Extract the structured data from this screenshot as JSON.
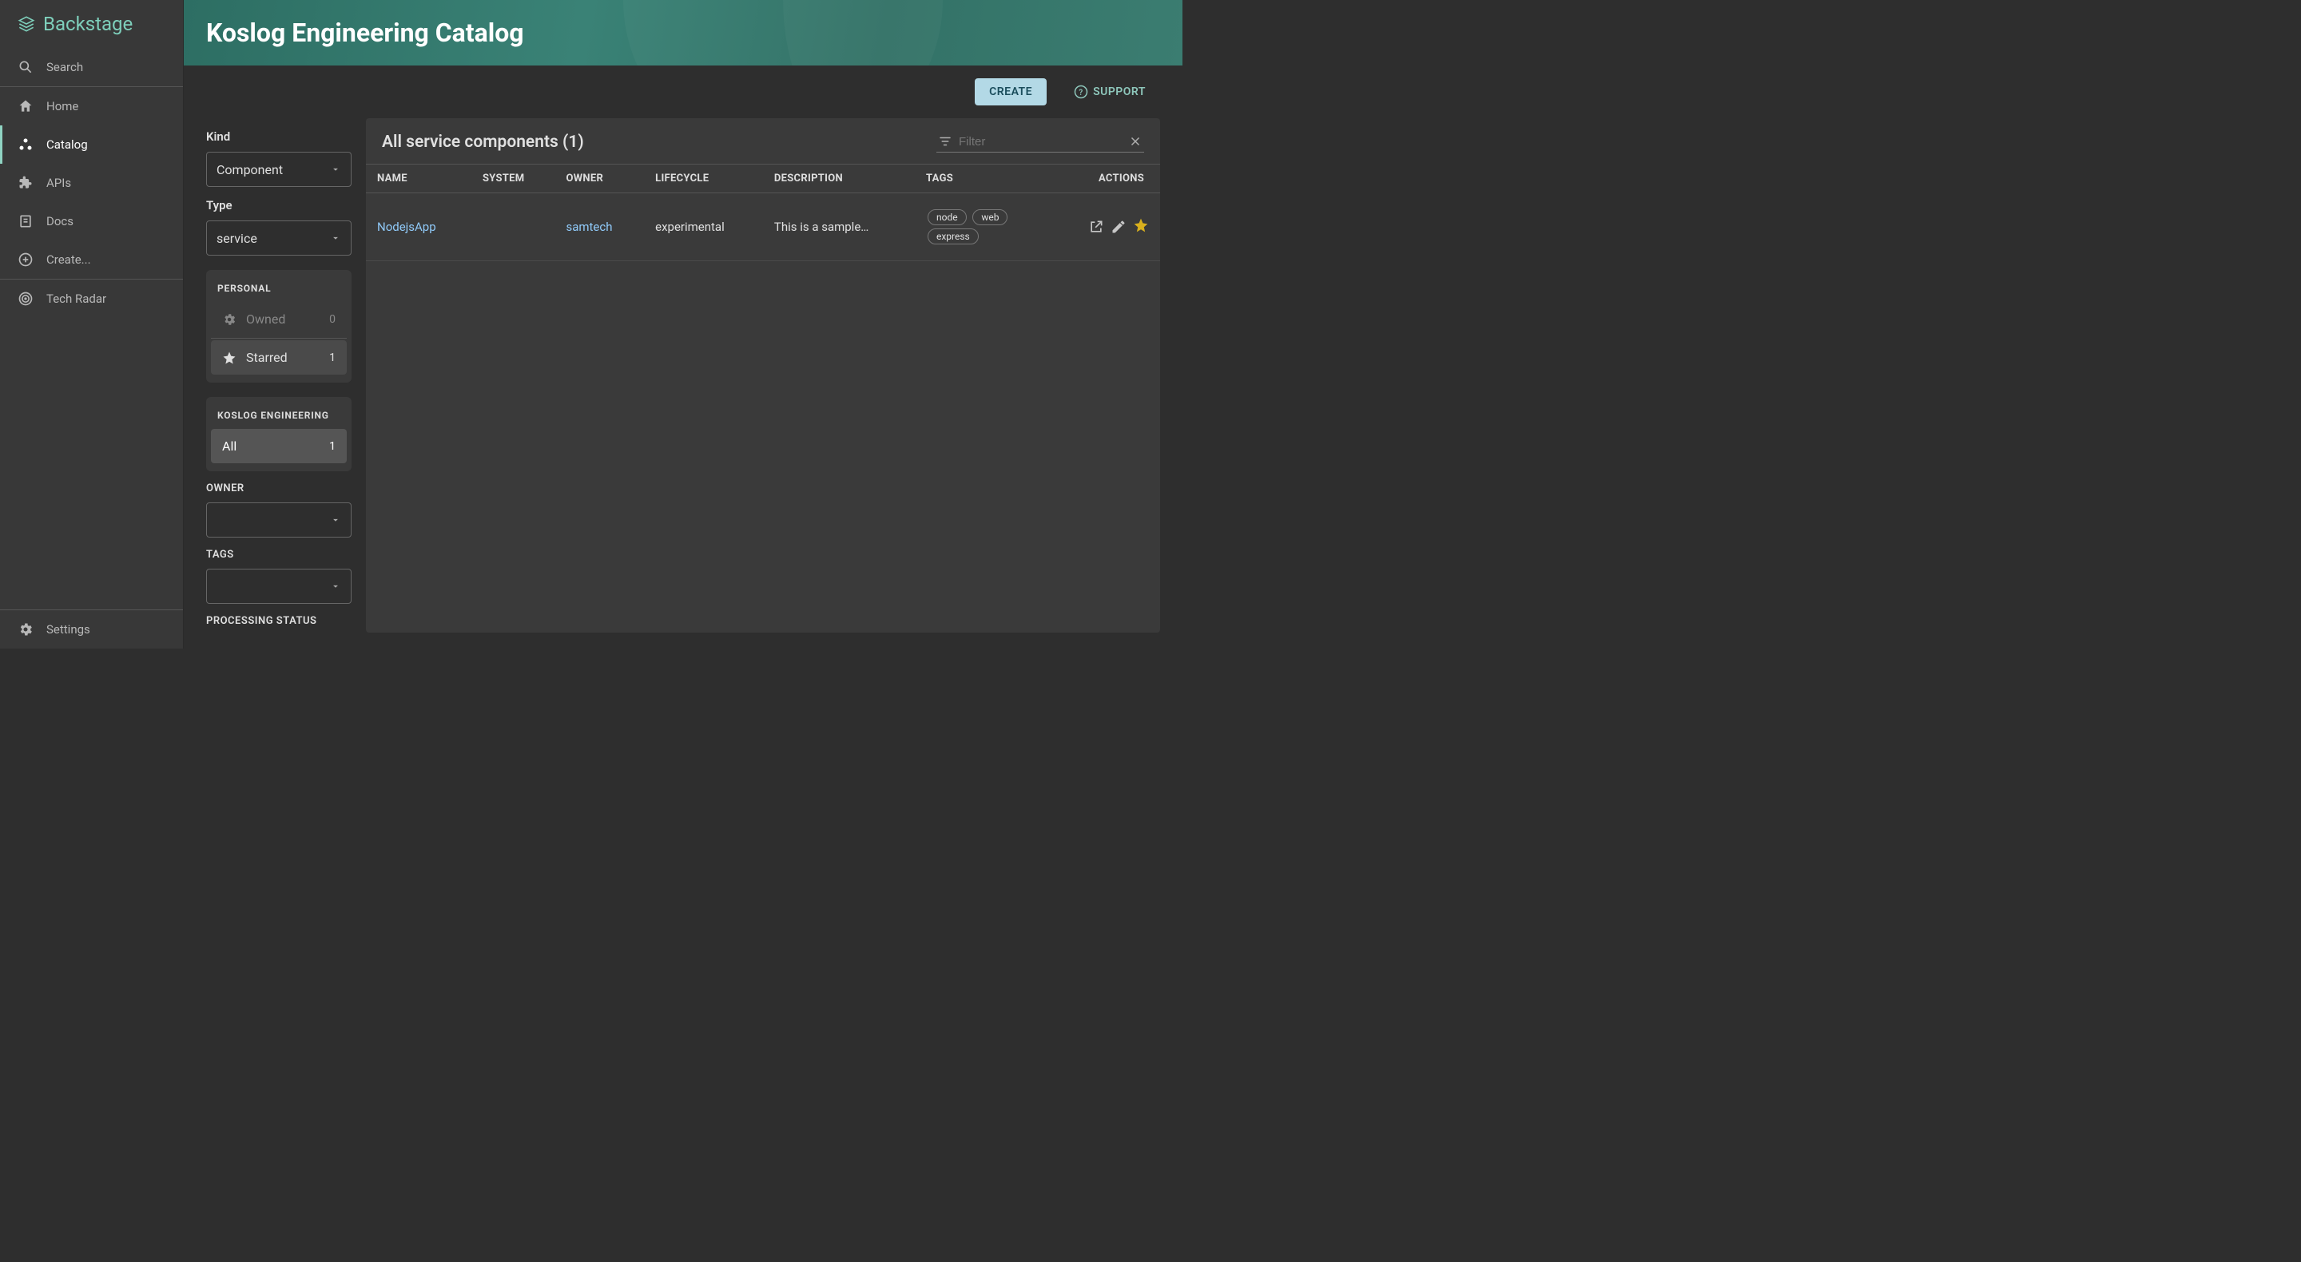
{
  "brand": "Backstage",
  "sidebar": {
    "search": "Search",
    "items": [
      {
        "label": "Home",
        "key": "home"
      },
      {
        "label": "Catalog",
        "key": "catalog"
      },
      {
        "label": "APIs",
        "key": "apis"
      },
      {
        "label": "Docs",
        "key": "docs"
      },
      {
        "label": "Create...",
        "key": "create"
      },
      {
        "label": "Tech Radar",
        "key": "radar"
      }
    ],
    "settings": "Settings"
  },
  "header": {
    "title": "Koslog Engineering Catalog"
  },
  "toolbar": {
    "create": "CREATE",
    "support": "SUPPORT"
  },
  "filters": {
    "kind_label": "Kind",
    "kind_value": "Component",
    "type_label": "Type",
    "type_value": "service",
    "personal_heading": "PERSONAL",
    "owned": {
      "label": "Owned",
      "count": "0"
    },
    "starred": {
      "label": "Starred",
      "count": "1"
    },
    "org_heading": "KOSLOG ENGINEERING",
    "all": {
      "label": "All",
      "count": "1"
    },
    "owner_label": "OWNER",
    "tags_label": "TAGS",
    "processing_label": "PROCESSING STATUS"
  },
  "table": {
    "title": "All service components (1)",
    "filter_placeholder": "Filter",
    "columns": [
      "NAME",
      "SYSTEM",
      "OWNER",
      "LIFECYCLE",
      "DESCRIPTION",
      "TAGS",
      "ACTIONS"
    ],
    "rows": [
      {
        "name": "NodejsApp",
        "system": "",
        "owner": "samtech",
        "lifecycle": "experimental",
        "description": "This is a sample…",
        "tags": [
          "node",
          "web",
          "express"
        ]
      }
    ]
  }
}
